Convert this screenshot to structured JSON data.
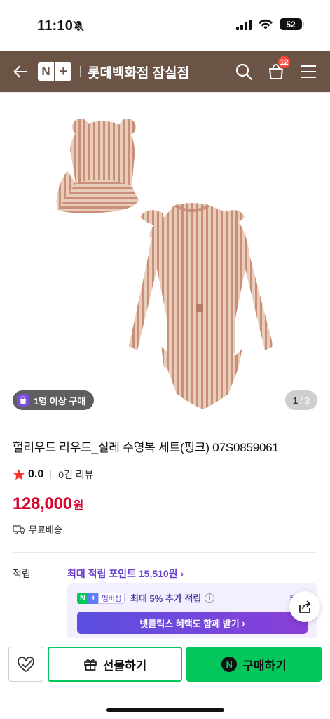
{
  "status_bar": {
    "time": "11:10",
    "battery": "52"
  },
  "header": {
    "logo_n": "N",
    "logo_plus": "+",
    "store_name": "롯데백화점 잠실점",
    "cart_count": "12",
    "background": "#6b5445"
  },
  "gallery": {
    "buyers_chip": "1명 이상 구매",
    "page_current": "1",
    "page_total": "3"
  },
  "product": {
    "title": "헐리우드 리우드_실레 수영복 세트(핑크) 07S0859061",
    "rating": "0.0",
    "review_count": "0건 리뷰",
    "price": "128,000",
    "currency": "원",
    "shipping": "무료배송",
    "price_color": "#d6052b"
  },
  "points": {
    "label": "적립",
    "max_text": "최대 적립 포인트 15,510원",
    "membership_chip_n": "N",
    "membership_chip_plus": "+",
    "membership_chip_label": "멤버십",
    "extra_text": "최대 5% 추가 적립",
    "extra_amount": "5,12",
    "netflix_button": "넷플릭스 혜택도 함께 받기"
  },
  "bottom_bar": {
    "gift_label": "선물하기",
    "buy_label": "구매하기",
    "pay_mark": "N",
    "accent": "#03c75a"
  }
}
